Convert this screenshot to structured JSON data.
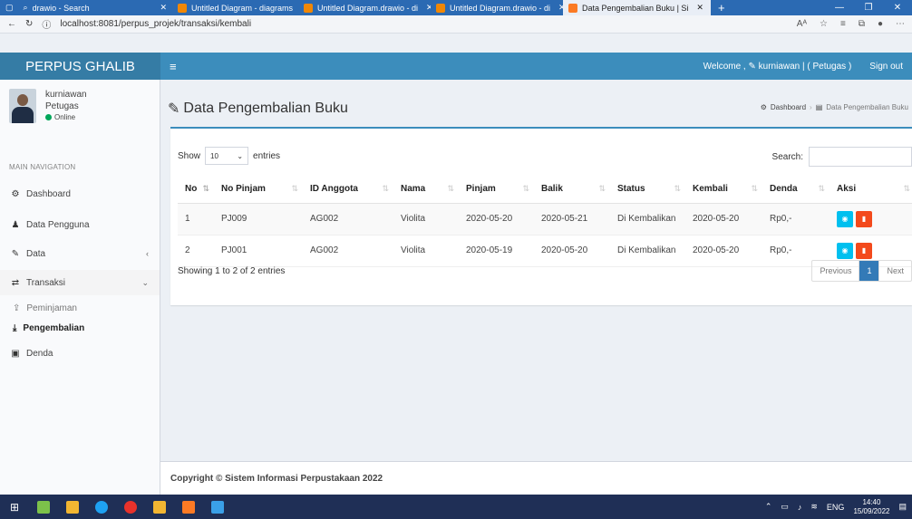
{
  "browser": {
    "tabs": [
      {
        "title": "drawio - Search",
        "icon_color": "#9fb8e0"
      },
      {
        "title": "Untitled Diagram - diagrams",
        "icon_color": "#f08705"
      },
      {
        "title": "Untitled Diagram.drawio - di",
        "icon_color": "#f08705"
      },
      {
        "title": "Untitled Diagram.drawio - di",
        "icon_color": "#f08705"
      },
      {
        "title": "Data Pengembalian Buku | Si",
        "icon_color": "#fb7a24"
      }
    ],
    "url": "localhost:8081/perpus_projek/transaksi/kembali"
  },
  "header": {
    "logo": "PERPUS GHALIB",
    "menu_toggle": "≡",
    "welcome": "Welcome , ✎ kurniawan | ( Petugas )",
    "signout": "Sign out"
  },
  "sidebar": {
    "user": {
      "name": "kurniawan",
      "role": "Petugas",
      "status": "Online"
    },
    "nav_header": "MAIN NAVIGATION",
    "items": {
      "dashboard": "Dashboard",
      "data_pengguna": "Data Pengguna",
      "data": "Data",
      "transaksi": "Transaksi",
      "peminjaman": "Peminjaman",
      "pengembalian": "Pengembalian",
      "denda": "Denda"
    }
  },
  "page": {
    "title": "Data Pengembalian Buku",
    "breadcrumb_home": "Dashboard",
    "breadcrumb_current": "Data Pengembalian Buku"
  },
  "table": {
    "show_label": "Show",
    "entries_value": "10",
    "entries_label": "entries",
    "search_label": "Search:",
    "columns": [
      "No",
      "No Pinjam",
      "ID Anggota",
      "Nama",
      "Pinjam",
      "Balik",
      "Status",
      "Kembali",
      "Denda",
      "Aksi"
    ],
    "rows": [
      [
        "1",
        "PJ009",
        "AG002",
        "Violita",
        "2020-05-20",
        "2020-05-21",
        "Di Kembalikan",
        "2020-05-20",
        "Rp0,-"
      ],
      [
        "2",
        "PJ001",
        "AG002",
        "Violita",
        "2020-05-19",
        "2020-05-20",
        "Di Kembalikan",
        "2020-05-20",
        "Rp0,-"
      ]
    ],
    "info": "Showing 1 to 2 of 2 entries",
    "pager": {
      "previous": "Previous",
      "current": "1",
      "next": "Next"
    }
  },
  "footer": {
    "copyright": "Copyright © Sistem Informasi Perpustakaan 2022"
  },
  "taskbar": {
    "apps": [
      "#2c6ad6",
      "#7cc14a",
      "#3b91e0",
      "#1ea1f2",
      "#e8322b",
      "#f2b632",
      "#fb7a24",
      "#3aa0e8"
    ],
    "tray_lang": "ENG",
    "time": "14:40",
    "date": "15/09/2022"
  }
}
